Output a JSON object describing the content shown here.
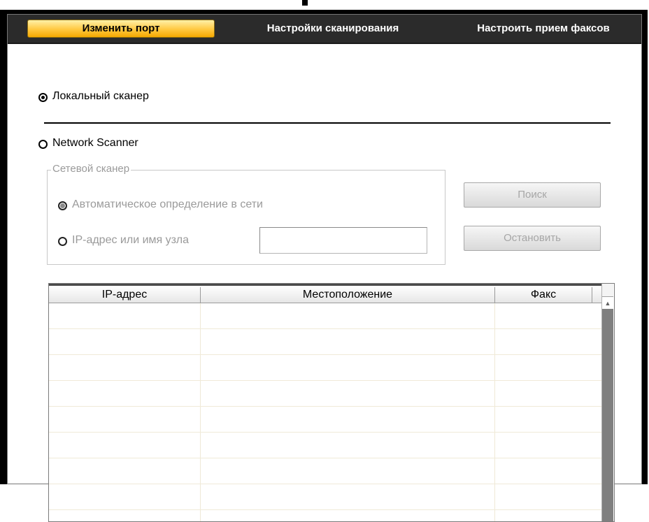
{
  "tabs": [
    {
      "label": "Изменить порт",
      "active": true
    },
    {
      "label": "Настройки сканирования",
      "active": false
    },
    {
      "label": "Настроить прием факсов",
      "active": false
    }
  ],
  "local_scanner": {
    "label": "Локальный сканер",
    "selected": true
  },
  "network_scanner": {
    "label": "Network Scanner",
    "selected": false
  },
  "network_group": {
    "title": "Сетевой сканер",
    "auto_detect_label": "Автоматическое определение в сети",
    "auto_detect_selected": true,
    "ip_label": "IP-адрес или имя узла",
    "ip_value": ""
  },
  "buttons": {
    "search": "Поиск",
    "stop": "Остановить"
  },
  "table": {
    "columns": [
      "IP-адрес",
      "Местоположение",
      "Факс"
    ],
    "rows": []
  },
  "colors": {
    "active_tab": "#ffc840",
    "tab_bar": "#2b2b2b",
    "disabled_text": "#9a9a9a"
  }
}
